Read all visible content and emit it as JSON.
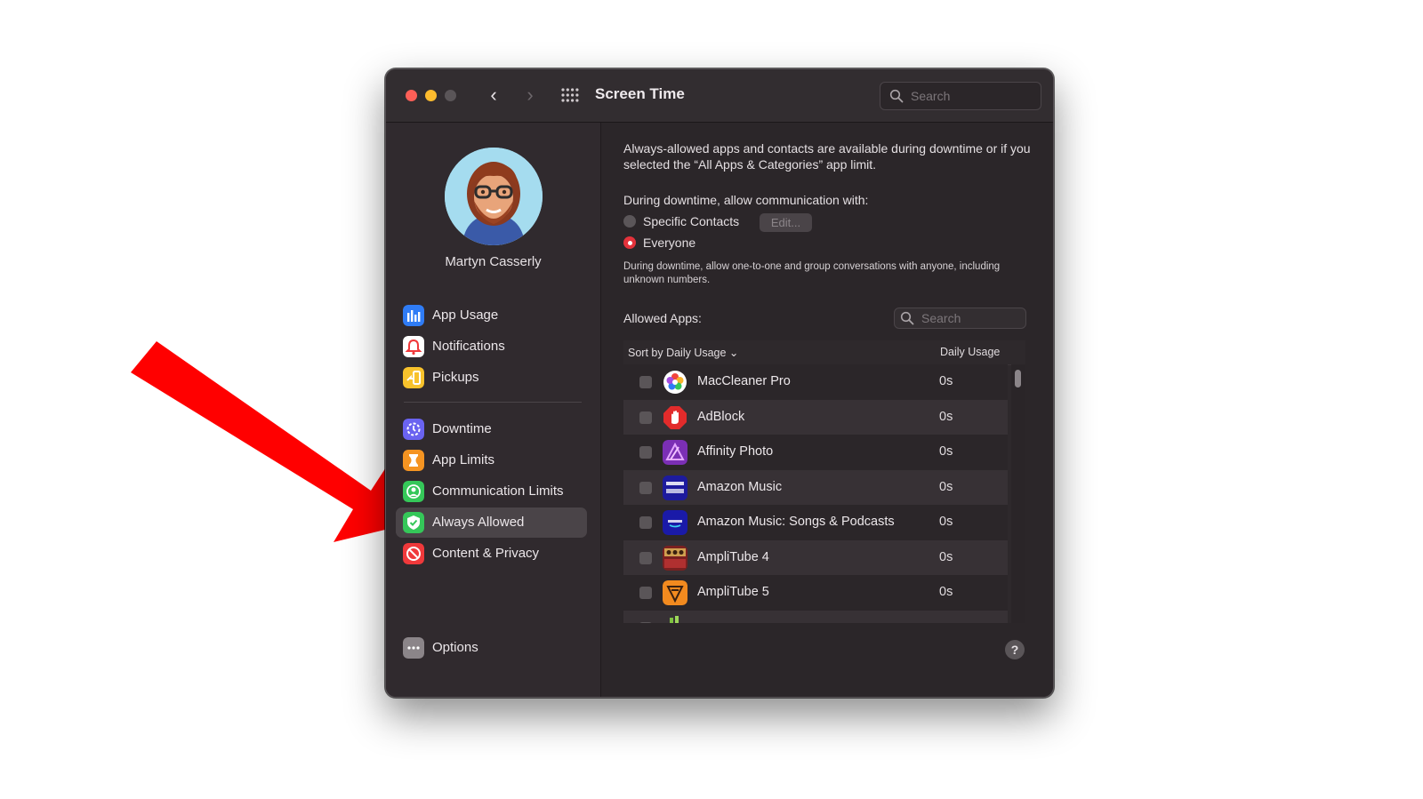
{
  "window": {
    "title": "Screen Time",
    "search_placeholder": "Search"
  },
  "user": {
    "name": "Martyn Casserly"
  },
  "sidebar": {
    "items": [
      {
        "label": "App Usage",
        "icon": "app-usage-icon",
        "color": "#2f7cf6"
      },
      {
        "label": "Notifications",
        "icon": "notifications-icon",
        "color": "#ffffff"
      },
      {
        "label": "Pickups",
        "icon": "pickups-icon",
        "color": "#f8c22c"
      },
      {
        "label": "Downtime",
        "icon": "downtime-icon",
        "color": "#6a63f0"
      },
      {
        "label": "App Limits",
        "icon": "app-limits-icon",
        "color": "#f59422"
      },
      {
        "label": "Communication Limits",
        "icon": "communication-limits-icon",
        "color": "#35c759"
      },
      {
        "label": "Always Allowed",
        "icon": "always-allowed-icon",
        "color": "#35c759",
        "selected": true
      },
      {
        "label": "Content & Privacy",
        "icon": "content-privacy-icon",
        "color": "#f0393b"
      }
    ],
    "options_label": "Options"
  },
  "main": {
    "intro": "Always-allowed apps and contacts are available during downtime or if you selected the “All Apps & Categories” app limit.",
    "communication_heading": "During downtime, allow communication with:",
    "radio_specific": "Specific Contacts",
    "edit_button": "Edit...",
    "radio_everyone": "Everyone",
    "selected_option": "Everyone",
    "note": "During downtime, allow one-to-one and group conversations with anyone, including unknown numbers.",
    "allowed_apps_label": "Allowed Apps:",
    "apps_search_placeholder": "Search",
    "sort_label": "Sort by Daily Usage ⌄",
    "usage_header": "Daily Usage",
    "apps": [
      {
        "name": "MacCleaner Pro",
        "usage": "0s",
        "icon": "maccleaner-pro-icon"
      },
      {
        "name": "AdBlock",
        "usage": "0s",
        "icon": "adblock-icon"
      },
      {
        "name": "Affinity Photo",
        "usage": "0s",
        "icon": "affinity-photo-icon"
      },
      {
        "name": "Amazon Music",
        "usage": "0s",
        "icon": "amazon-music-icon"
      },
      {
        "name": "Amazon Music: Songs & Podcasts",
        "usage": "0s",
        "icon": "amazon-music-songs-icon"
      },
      {
        "name": "AmpliTube 4",
        "usage": "0s",
        "icon": "amplitube-4-icon"
      },
      {
        "name": "AmpliTube 5",
        "usage": "0s",
        "icon": "amplitube-5-icon"
      }
    ],
    "help_label": "?"
  },
  "annotation": {
    "arrow_color": "#ff0000"
  }
}
